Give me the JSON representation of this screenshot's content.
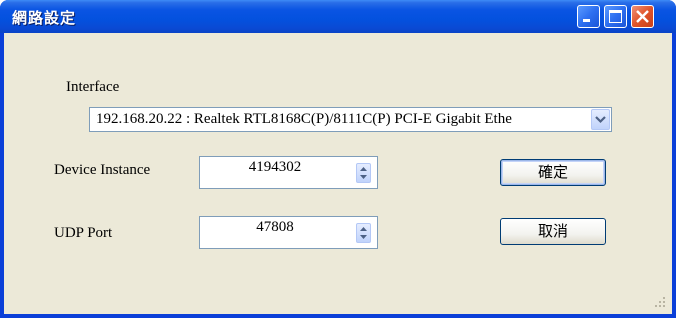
{
  "window": {
    "title": "網路設定",
    "controls": {
      "minimize": "minimize-icon",
      "maximize": "maximize-icon",
      "close": "close-icon"
    }
  },
  "interface": {
    "label": "Interface",
    "selected": "192.168.20.22 : Realtek RTL8168C(P)/8111C(P) PCI-E Gigabit Ethe"
  },
  "device_instance": {
    "label": "Device Instance",
    "value": "4194302"
  },
  "udp_port": {
    "label": "UDP Port",
    "value": "47808"
  },
  "buttons": {
    "ok": "確定",
    "cancel": "取消"
  },
  "colors": {
    "titlebar": "#0a54e3",
    "client": "#ece9d8",
    "close": "#e0542a"
  }
}
